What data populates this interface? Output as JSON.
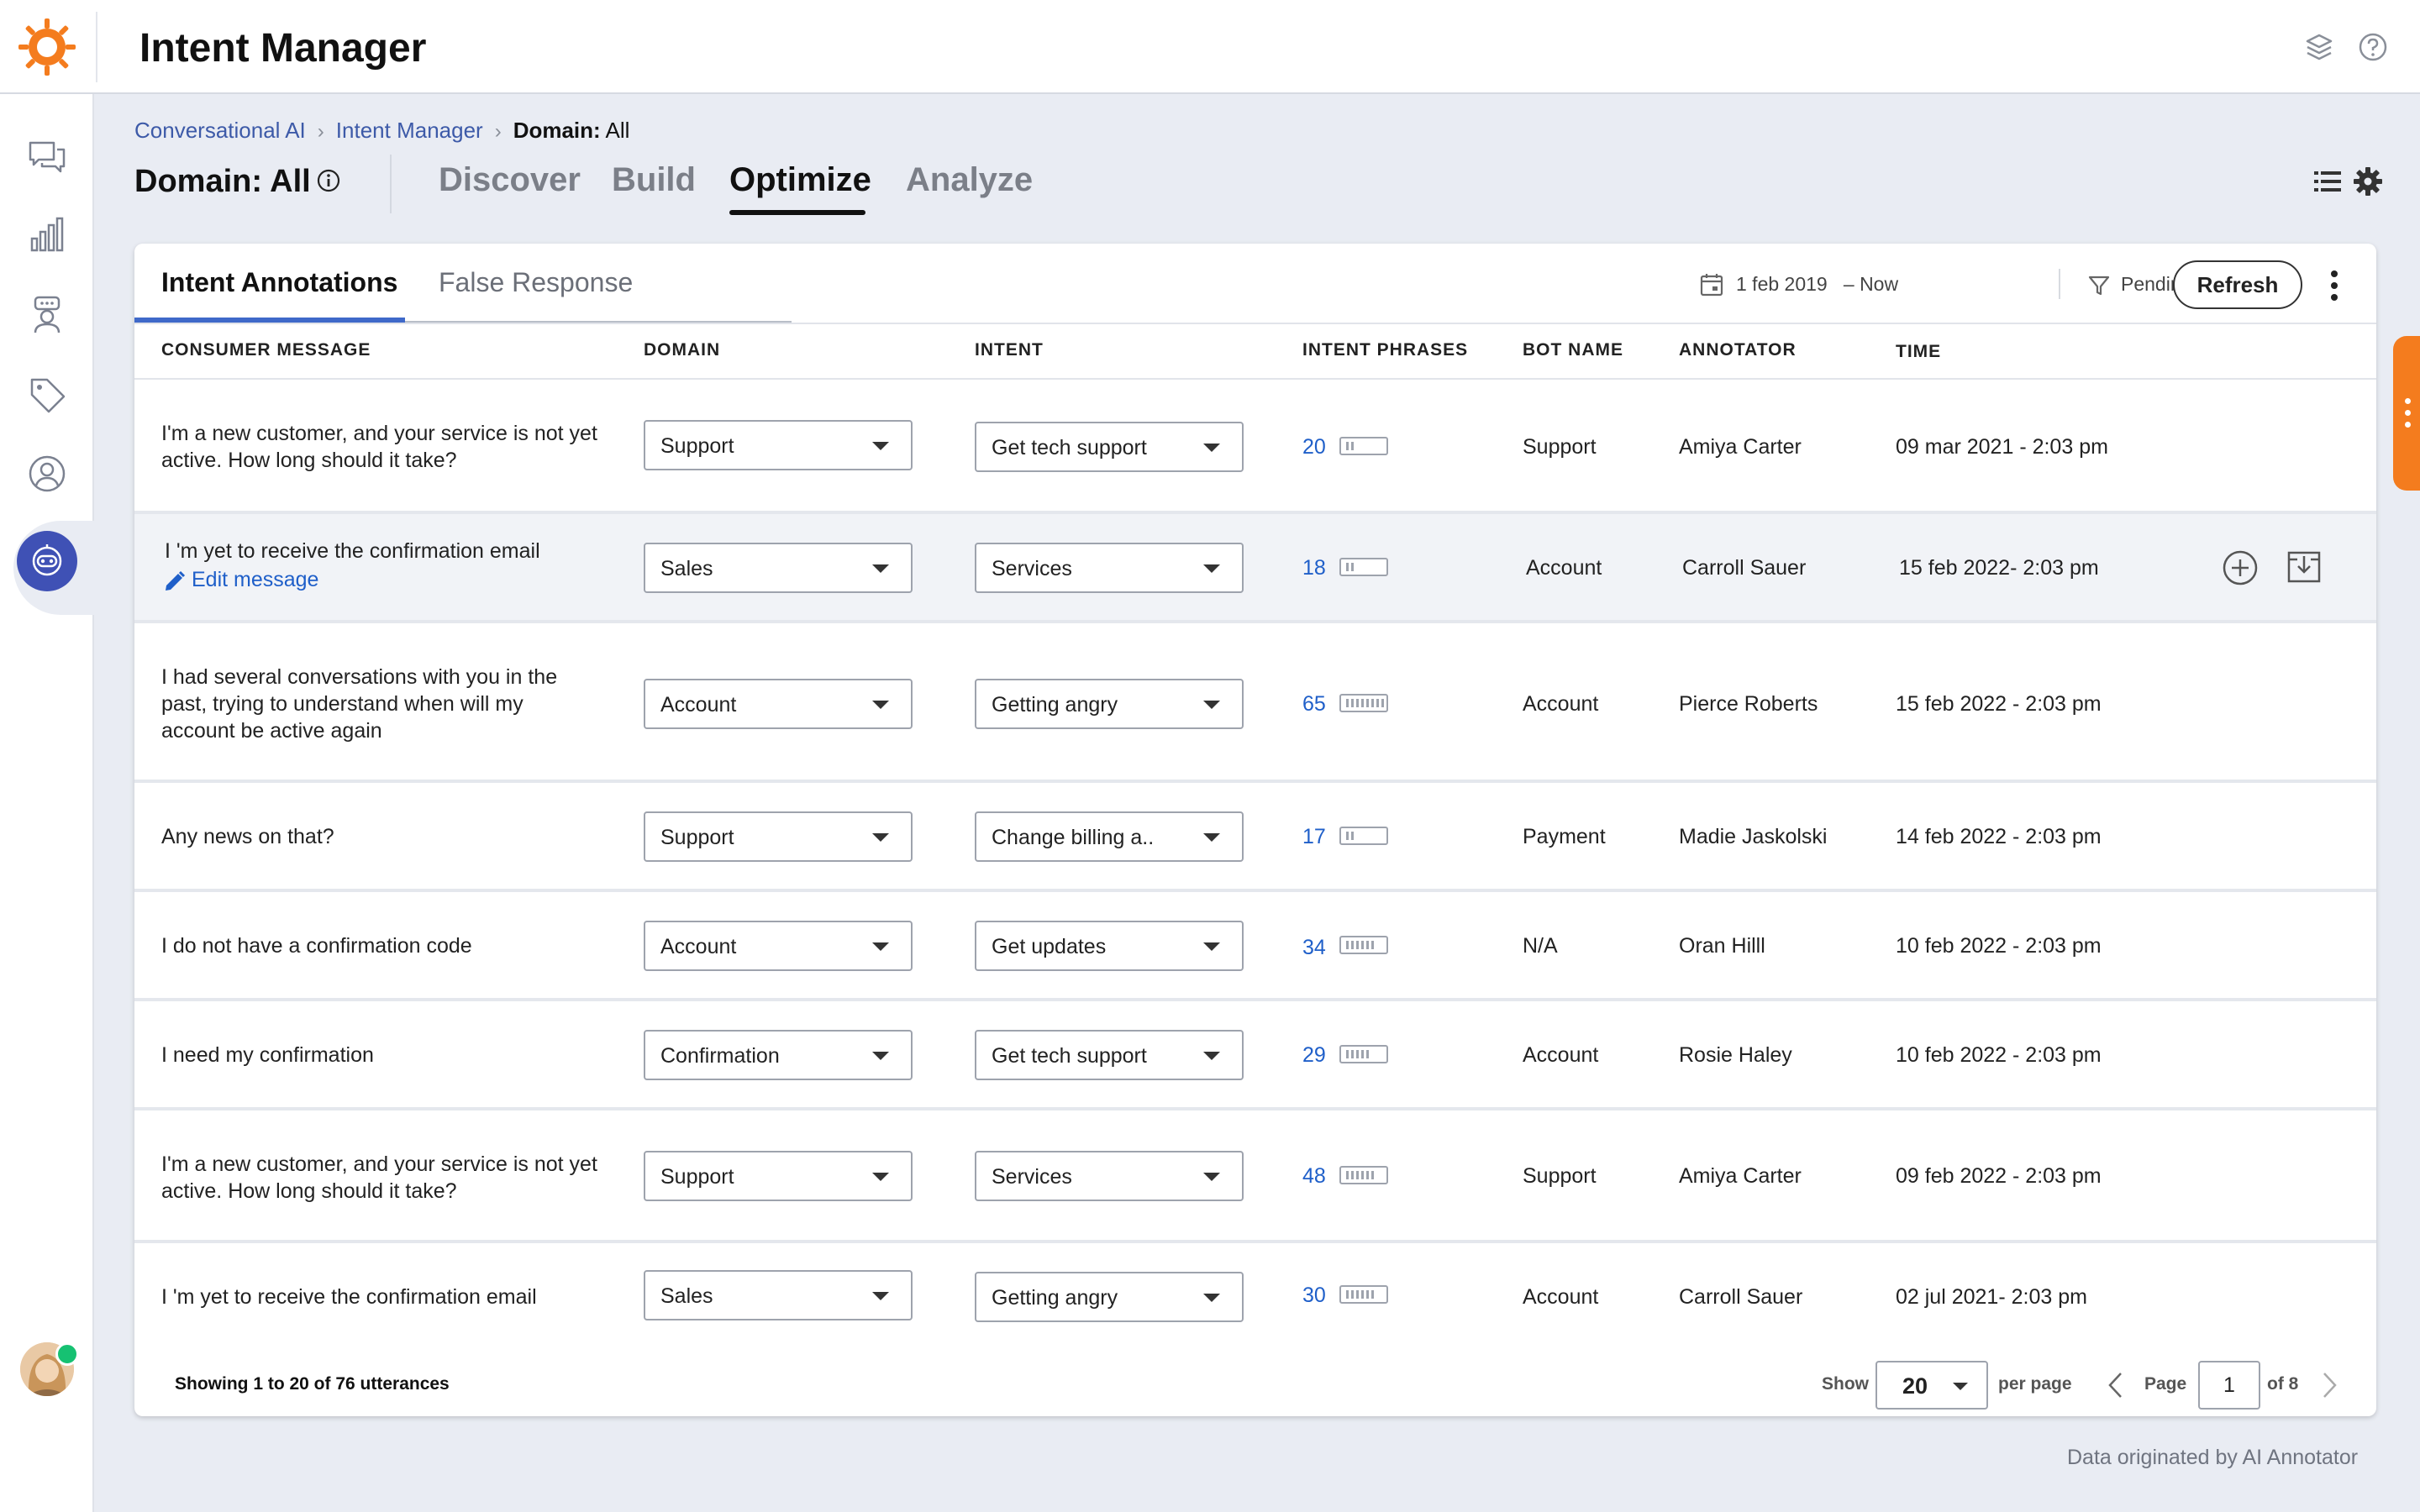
{
  "app": {
    "title": "Intent Manager"
  },
  "breadcrumb": {
    "items": [
      "Conversational AI",
      "Intent Manager"
    ],
    "current_prefix": "Domain:",
    "current_value": "All"
  },
  "page": {
    "title": "Domain: All"
  },
  "main_tabs": [
    {
      "label": "Discover",
      "active": false
    },
    {
      "label": "Build",
      "active": false
    },
    {
      "label": "Optimize",
      "active": true
    },
    {
      "label": "Analyze",
      "active": false
    }
  ],
  "sub_tabs": [
    {
      "label": "Intent Annotations",
      "active": true
    },
    {
      "label": "False Response",
      "active": false
    }
  ],
  "filters": {
    "date_from": "1 feb 2019",
    "date_to": "– Now",
    "status": "Pending review",
    "refresh_label": "Refresh"
  },
  "table": {
    "columns": [
      "CONSUMER MESSAGE",
      "DOMAIN",
      "INTENT",
      "INTENT PHRASES",
      "BOT NAME",
      "ANNOTATOR",
      "TIME"
    ],
    "rows": [
      {
        "message": "I'm a new customer, and your service is not yet active. How long should it take?",
        "domain": "Support",
        "intent": "Get tech support",
        "phrases": "20",
        "bot": "Support",
        "annotator": "Amiya Carter",
        "time": "09 mar 2021 - 2:03 pm"
      },
      {
        "message": "I 'm yet to receive the confirmation email",
        "edit_label": "Edit message",
        "domain": "Sales",
        "intent": "Services",
        "phrases": "18",
        "bot": "Account",
        "annotator": "Carroll Sauer",
        "time": "15 feb 2022- 2:03 pm"
      },
      {
        "message": "I had several conversations with you in the past, trying to understand when will my account be active again",
        "domain": "Account",
        "intent": "Getting angry",
        "phrases": "65",
        "bot": "Account",
        "annotator": "Pierce Roberts",
        "time": "15 feb 2022 - 2:03 pm"
      },
      {
        "message": "Any news on that?",
        "domain": "Support",
        "intent": "Change billing a..",
        "phrases": "17",
        "bot": "Payment",
        "annotator": "Madie Jaskolski",
        "time": "14 feb 2022 - 2:03 pm"
      },
      {
        "message": "I do not have a confirmation code",
        "domain": "Account",
        "intent": "Get updates",
        "phrases": "34",
        "bot": "N/A",
        "annotator": "Oran Hilll",
        "time": "10 feb 2022 - 2:03 pm"
      },
      {
        "message": "I need my confirmation",
        "domain": "Confirmation",
        "intent": "Get tech support",
        "phrases": "29",
        "bot": "Account",
        "annotator": "Rosie Haley",
        "time": "10 feb 2022 - 2:03 pm"
      },
      {
        "message": "I'm a new customer, and your service is not yet active. How long should it take?",
        "domain": "Support",
        "intent": "Services",
        "phrases": "48",
        "bot": "Support",
        "annotator": "Amiya Carter",
        "time": "09 feb 2022 - 2:03 pm"
      },
      {
        "message": "I 'm yet to receive the confirmation email",
        "domain": "Sales",
        "intent": "Getting angry",
        "phrases": "30",
        "bot": "Account",
        "annotator": "Carroll Sauer",
        "time": "02 jul 2021- 2:03 pm"
      }
    ]
  },
  "footer": {
    "showing": "Showing 1 to 20 of 76 utterances",
    "show_label": "Show",
    "per_page_value": "20",
    "per_page_label": "per page",
    "page_label": "Page",
    "page_value": "1",
    "of_label": "of 8"
  },
  "data_origin": "Data originated by AI Annotator",
  "colors": {
    "accent": "#3f69c9",
    "brand_orange": "#f47c1e",
    "link": "#1f5fc9",
    "active_nav": "#3f51b5"
  },
  "icons": {
    "logo": "sun-logo-icon",
    "top_right": [
      "layers-icon",
      "help-icon"
    ],
    "sidebar": [
      "conversations-icon",
      "analytics-icon",
      "agent-icon",
      "tag-icon",
      "user-icon",
      "bot-icon",
      "apps-grid-icon"
    ],
    "toolbar": [
      "list-icon",
      "gear-icon"
    ],
    "row_actions": [
      "add-circle-icon",
      "archive-icon"
    ]
  }
}
